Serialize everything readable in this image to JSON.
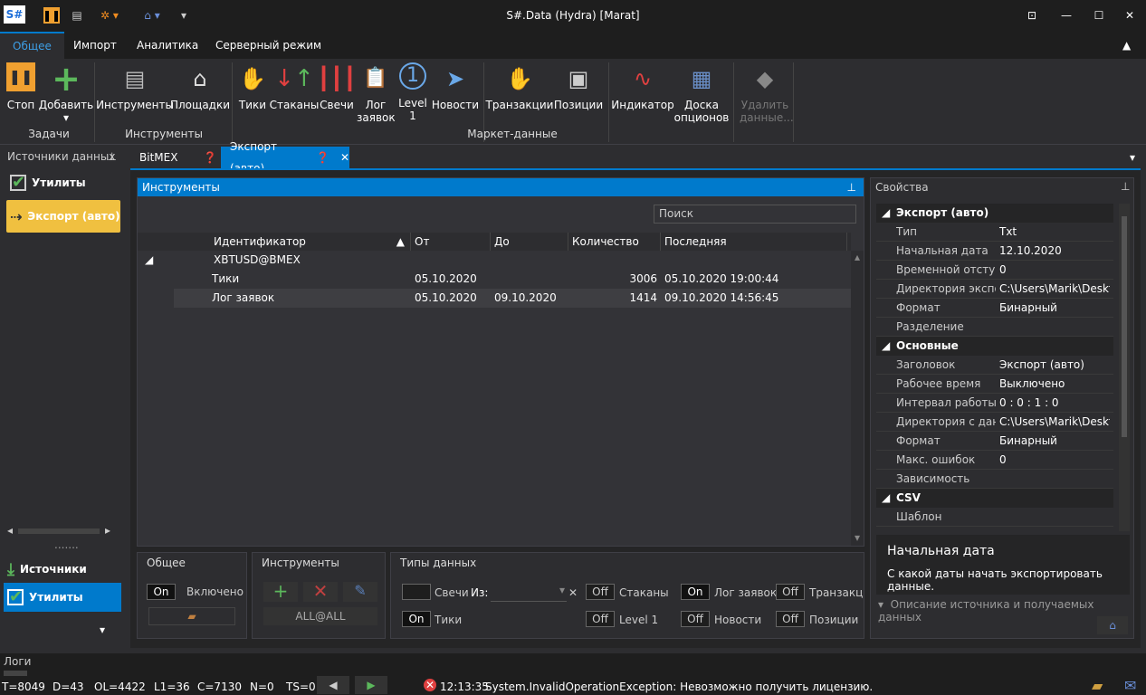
{
  "window": {
    "title": "S#.Data (Hydra) [Marat]",
    "logo": "S#"
  },
  "ribbon_tabs": [
    "Общее",
    "Импорт",
    "Аналитика",
    "Серверный режим"
  ],
  "ribbon": {
    "stop": "Стоп",
    "add": "Добавить",
    "instruments": "Инструменты",
    "venues": "Площадки",
    "ticks": "Тики",
    "depths": "Стаканы",
    "candles": "Свечи",
    "orderlog": "Лог заявок",
    "level1": "Level 1",
    "news": "Новости",
    "transactions": "Транзакции",
    "positions": "Позиции",
    "indicator": "Индикатор",
    "options": "Доска опционов",
    "delete": "Удалить данные...",
    "groups": {
      "tasks": "Задачи",
      "instruments": "Инструменты",
      "market": "Маркет-данные"
    }
  },
  "left": {
    "header": "Источники данных",
    "utilities": "Утилиты",
    "export": "Экспорт (авто)",
    "sources": "Источники",
    "utilities2": "Утилиты"
  },
  "doc_tabs": [
    {
      "label": "BitMEX"
    },
    {
      "label": "Экспорт (авто)"
    }
  ],
  "instruments": {
    "header": "Инструменты",
    "search": "Поиск",
    "columns": [
      "Идентификатор",
      "От",
      "До",
      "Количество",
      "Последняя"
    ],
    "group": "XBTUSD@BMEX",
    "rows": [
      {
        "id": "Тики",
        "from": "05.10.2020",
        "to": "",
        "count": "3006",
        "last": "05.10.2020 19:00:44"
      },
      {
        "id": "Лог заявок",
        "from": "05.10.2020",
        "to": "09.10.2020",
        "count": "1414",
        "last": "09.10.2020 14:56:45"
      }
    ]
  },
  "bottom": {
    "general": {
      "title": "Общее",
      "toggle": "On",
      "label": "Включено"
    },
    "instruments": {
      "title": "Инструменты",
      "all": "ALL@ALL"
    },
    "types": {
      "title": "Типы данных",
      "candles": "Свечи",
      "from": "Из:",
      "ticks": "Тики",
      "depths": "Стаканы",
      "level1": "Level 1",
      "orderlog": "Лог заявок",
      "news": "Новости",
      "trans": "Транзакц",
      "positions": "Позиции",
      "on": "On",
      "off": "Off"
    }
  },
  "props": {
    "header": "Свойства",
    "cat1": "Экспорт (авто)",
    "r1": [
      [
        "Тип",
        "Txt"
      ],
      [
        "Начальная дата",
        "12.10.2020"
      ],
      [
        "Временной отступ",
        "0"
      ],
      [
        "Директория экспо...",
        "C:\\Users\\Marik\\Deskt..."
      ],
      [
        "Формат",
        "Бинарный"
      ],
      [
        "Разделение",
        ""
      ]
    ],
    "cat2": "Основные",
    "r2": [
      [
        "Заголовок",
        "Экспорт (авто)"
      ],
      [
        "Рабочее время",
        "Выключено"
      ],
      [
        "Интервал работы",
        "0 : 0 : 1 : 0"
      ],
      [
        "Директория с дан...",
        "C:\\Users\\Marik\\Deskt..."
      ],
      [
        "Формат",
        "Бинарный"
      ],
      [
        "Макс. ошибок",
        "0"
      ],
      [
        "Зависимость",
        ""
      ]
    ],
    "cat3": "CSV",
    "r3": [
      [
        "Шаблон",
        ""
      ]
    ],
    "desc_title": "Начальная дата",
    "desc_text": "С какой даты начать экспортировать данные.",
    "footer": "Описание источника и получаемых данных"
  },
  "status": {
    "logs": "Логи",
    "t": "T=8049",
    "d": "D=43",
    "ol": "OL=4422",
    "l1": "L1=36",
    "c": "C=7130",
    "n": "N=0",
    "ts": "TS=0",
    "time": "12:13:35",
    "msg": "System.InvalidOperationException: Невозможно получить лицензию."
  }
}
